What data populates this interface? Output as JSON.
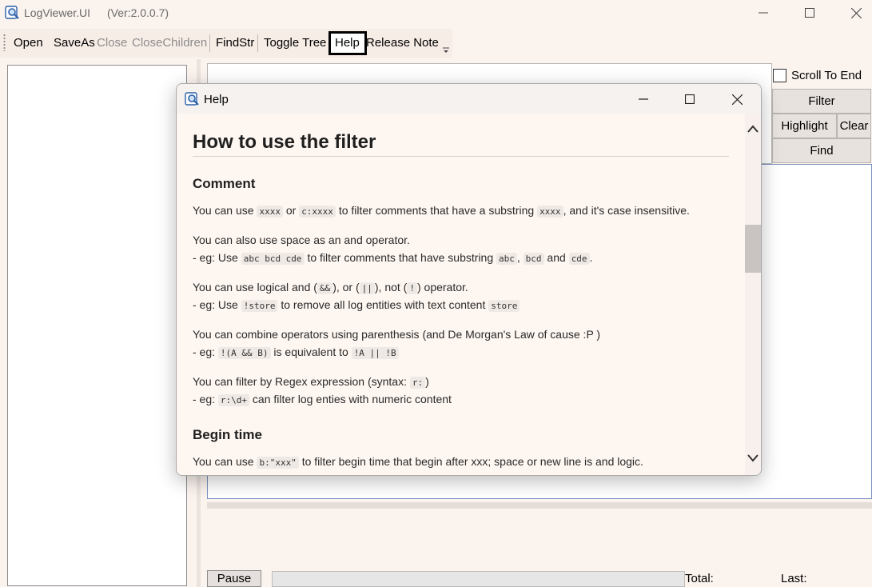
{
  "window": {
    "title": "LogViewer.UI",
    "version": "(Ver:2.0.0.7)"
  },
  "toolbar": {
    "open": "Open",
    "save_as": "SaveAs",
    "close": "Close",
    "close_children": "CloseChildren",
    "find_str": "FindStr",
    "toggle_tree": "Toggle Tree",
    "help": "Help",
    "release_note": "Release Note"
  },
  "filter_panel": {
    "scroll_to_end": "Scroll To End",
    "scroll_to_end_checked": false,
    "filter": "Filter",
    "highlight": "Highlight",
    "clear": "Clear",
    "find": "Find"
  },
  "status": {
    "pause": "Pause",
    "total": "Total:",
    "last": "Last:"
  },
  "help_dialog": {
    "title": "Help",
    "heading": "How to use the filter",
    "sec_comment": "Comment",
    "p1": {
      "a": "You can use ",
      "c1": "xxxx",
      "b": " or ",
      "c2": "c:xxxx",
      "d": " to filter comments that have a substring ",
      "c3": "xxxx",
      "e": ", and it's case insensitive."
    },
    "p2": {
      "line1": "You can also use space as an and operator.",
      "a": "- eg: Use ",
      "c1": "abc bcd cde",
      "b": " to filter comments that have substring ",
      "c2": "abc",
      "sep1": ", ",
      "c3": "bcd",
      "and": " and ",
      "c4": "cde",
      "end": "."
    },
    "p3": {
      "a": "You can use logical and (",
      "c1": "&&",
      "b": "), or (",
      "c2": "||",
      "c": "), not (",
      "c3": "!",
      "d": ") operator.",
      "e": "- eg: Use ",
      "c4": "!store",
      "f": " to remove all log entities with text content ",
      "c5": "store"
    },
    "p4": {
      "line1": "You can combine operators using parenthesis (and De Morgan's Law of cause :P )",
      "a": "- eg: ",
      "c1": "!(A && B)",
      "b": " is equivalent to ",
      "c2": "!A || !B"
    },
    "p5": {
      "a": "You can filter by Regex expression (syntax: ",
      "c1": "r:",
      "b": ")",
      "e": "- eg: ",
      "c2": "r:\\d+",
      "f": " can filter log enties with numeric content"
    },
    "sec_begin": "Begin time",
    "p6": {
      "a": "You can use ",
      "c1": "b:\"xxx\"",
      "b": " to filter begin time that begin after xxx; space or new line is and logic."
    }
  }
}
